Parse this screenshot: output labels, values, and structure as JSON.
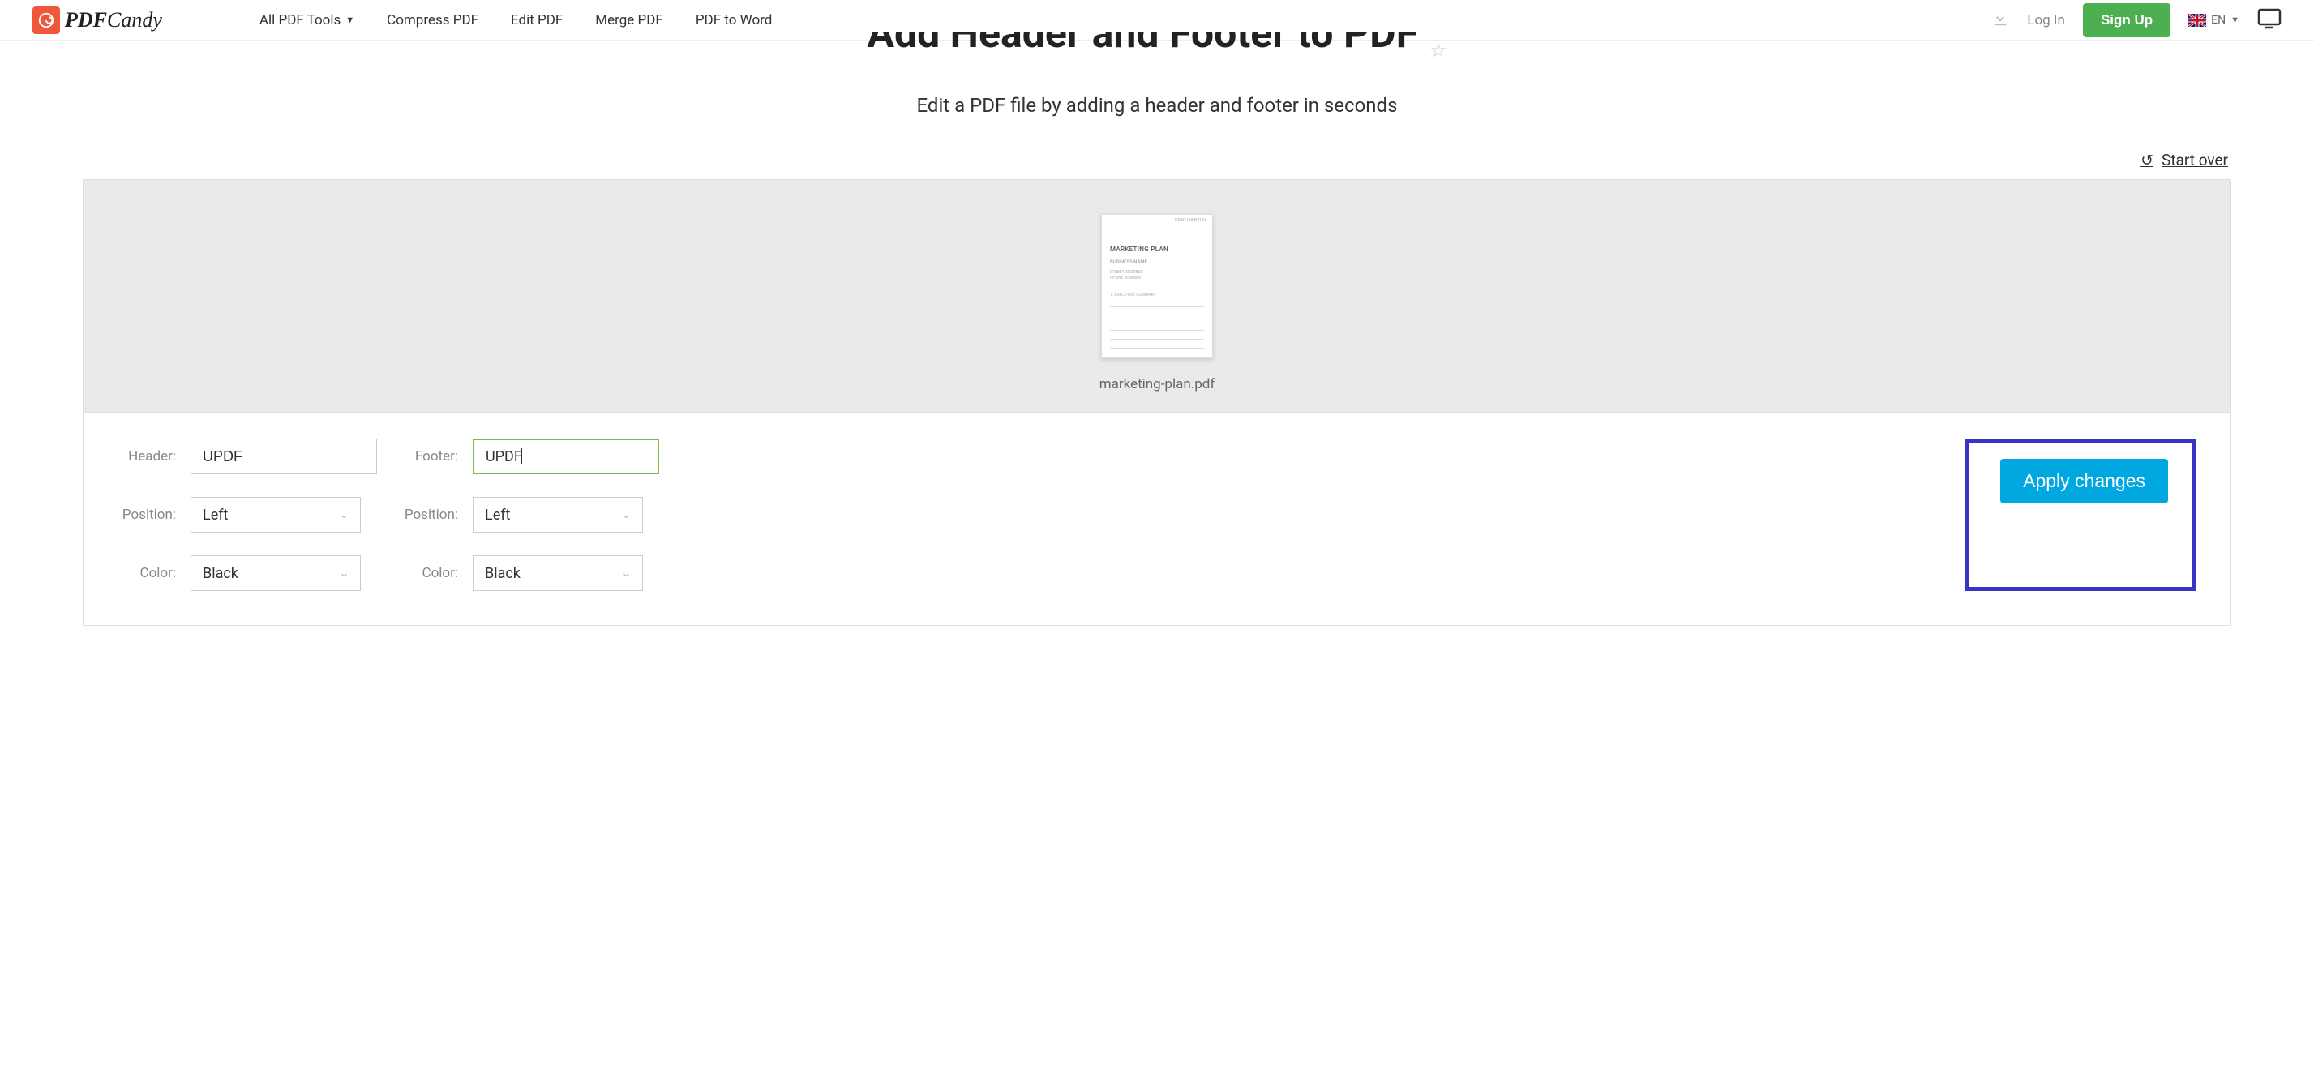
{
  "nav": {
    "logo": "PDF",
    "logo_suffix": "Candy",
    "all_tools": "All PDF Tools",
    "compress": "Compress PDF",
    "edit": "Edit PDF",
    "merge": "Merge PDF",
    "to_word": "PDF to Word",
    "login": "Log In",
    "signup": "Sign Up",
    "lang": "EN"
  },
  "page": {
    "title": "Add Header and Footer to PDF",
    "subtitle": "Edit a PDF file by adding a header and footer in seconds",
    "start_over": "Start over",
    "file_name": "marketing-plan.pdf"
  },
  "thumb": {
    "conf": "CONFIDENTIAL",
    "title": "MARKETING PLAN",
    "sub": "BUSINESS NAME",
    "desc1": "STREET ADDRESS",
    "desc2": "PHONE NUMBER",
    "section": "1. EXECUTIVE SUMMARY",
    "pg": "1"
  },
  "form": {
    "header_label": "Header:",
    "header_value": "UPDF",
    "footer_label": "Footer:",
    "footer_value": "UPDF",
    "position_label": "Position:",
    "position_value": "Left",
    "color_label": "Color:",
    "color_value": "Black",
    "apply": "Apply changes"
  }
}
